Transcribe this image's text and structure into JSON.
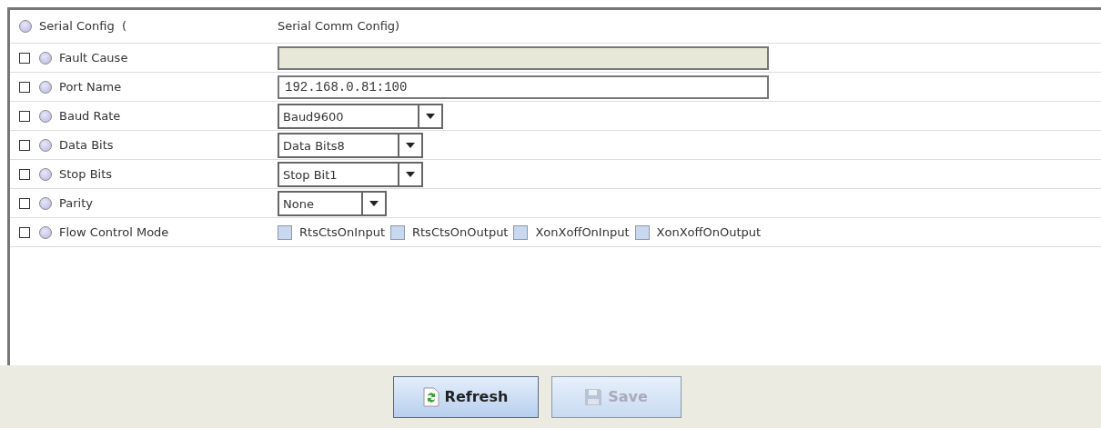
{
  "header": {
    "name": "Serial Config  (",
    "type": "Serial Comm Config)"
  },
  "rows": [
    {
      "label": "Fault Cause",
      "checked": false,
      "kind": "text",
      "value": "",
      "disabled": true
    },
    {
      "label": "Port Name",
      "checked": false,
      "kind": "text",
      "value": "192.168.0.81:100",
      "disabled": false
    },
    {
      "label": "Baud Rate",
      "checked": false,
      "kind": "select",
      "value": "Baud9600"
    },
    {
      "label": "Data Bits",
      "checked": false,
      "kind": "select",
      "value": "Data Bits8"
    },
    {
      "label": "Stop Bits",
      "checked": false,
      "kind": "select",
      "value": "Stop Bit1"
    },
    {
      "label": "Parity",
      "checked": false,
      "kind": "select",
      "value": "None"
    },
    {
      "label": "Flow Control Mode",
      "checked": false,
      "kind": "flags",
      "options": [
        {
          "label": "RtsCtsOnInput",
          "checked": false
        },
        {
          "label": "RtsCtsOnOutput",
          "checked": false
        },
        {
          "label": "XonXoffOnInput",
          "checked": false
        },
        {
          "label": "XonXoffOnOutput",
          "checked": false
        }
      ]
    }
  ],
  "buttons": [
    {
      "label": "Refresh",
      "kind": "refresh",
      "disabled": false
    },
    {
      "label": "Save",
      "kind": "save",
      "disabled": true
    }
  ]
}
